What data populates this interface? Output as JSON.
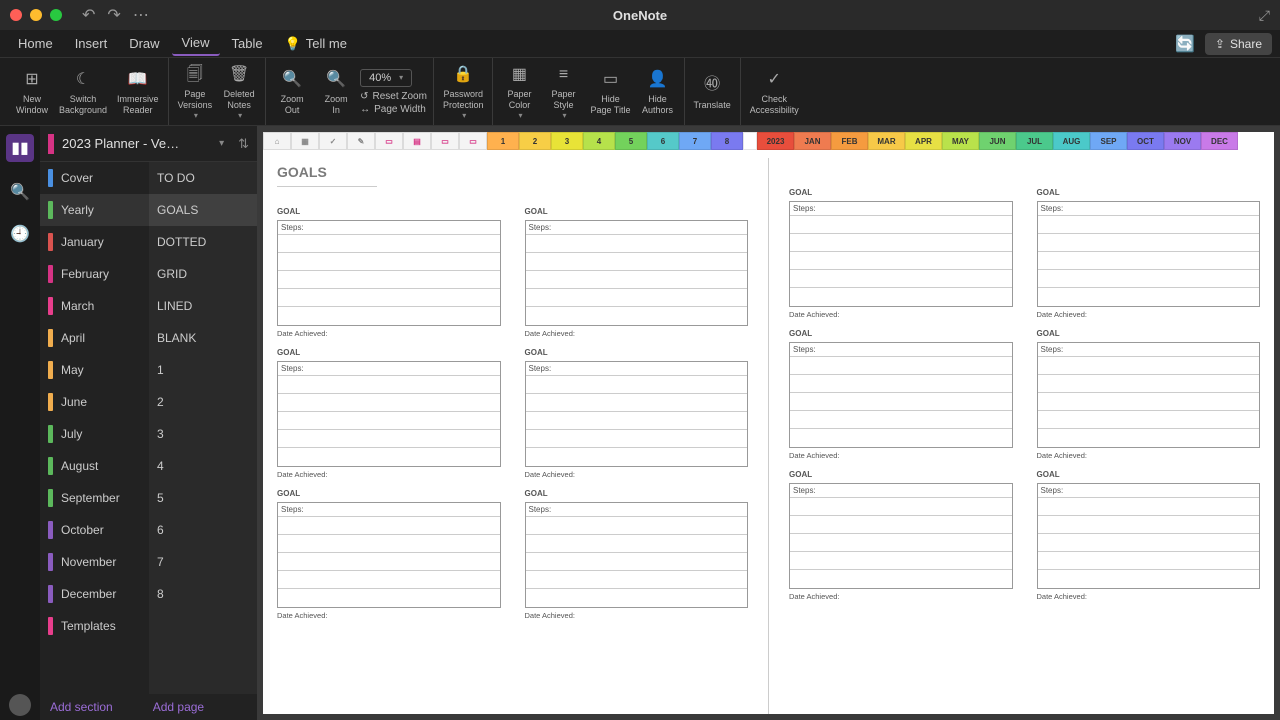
{
  "app": {
    "title": "OneNote"
  },
  "menu": {
    "items": [
      "Home",
      "Insert",
      "Draw",
      "View",
      "Table"
    ],
    "tellme": "Tell me",
    "share": "Share"
  },
  "ribbon": {
    "new_window": "New\nWindow",
    "switch_bg": "Switch\nBackground",
    "immersive": "Immersive\nReader",
    "page_versions": "Page\nVersions",
    "deleted_notes": "Deleted\nNotes",
    "zoom_out": "Zoom\nOut",
    "zoom_in": "Zoom\nIn",
    "zoom_level": "40%",
    "reset_zoom": "Reset Zoom",
    "page_width": "Page Width",
    "password": "Password\nProtection",
    "paper_color": "Paper\nColor",
    "paper_style": "Paper\nStyle",
    "hide_title": "Hide\nPage Title",
    "hide_authors": "Hide\nAuthors",
    "translate": "Translate",
    "accessibility": "Check\nAccessibility"
  },
  "notebook": {
    "name": "2023 Planner - Ve…"
  },
  "sections": [
    {
      "label": "Cover",
      "color": "#4a90e2"
    },
    {
      "label": "Yearly",
      "color": "#5cb85c"
    },
    {
      "label": "January",
      "color": "#d9534f"
    },
    {
      "label": "February",
      "color": "#d63384"
    },
    {
      "label": "March",
      "color": "#e83e8c"
    },
    {
      "label": "April",
      "color": "#f0ad4e"
    },
    {
      "label": "May",
      "color": "#f0ad4e"
    },
    {
      "label": "June",
      "color": "#f0ad4e"
    },
    {
      "label": "July",
      "color": "#5cb85c"
    },
    {
      "label": "August",
      "color": "#5cb85c"
    },
    {
      "label": "September",
      "color": "#5cb85c"
    },
    {
      "label": "October",
      "color": "#8a5cbf"
    },
    {
      "label": "November",
      "color": "#8a5cbf"
    },
    {
      "label": "December",
      "color": "#8a5cbf"
    },
    {
      "label": "Templates",
      "color": "#e83e8c"
    }
  ],
  "pages": [
    "TO DO",
    "GOALS",
    "DOTTED",
    "GRID",
    "LINED",
    "BLANK",
    "1",
    "2",
    "3",
    "4",
    "5",
    "6",
    "7",
    "8"
  ],
  "footer": {
    "add_section": "Add section",
    "add_page": "Add page"
  },
  "canvas": {
    "title": "GOALS",
    "goal_label": "GOAL",
    "steps_label": "Steps:",
    "date_label": "Date Achieved:",
    "icon_tabs": [
      "⌂",
      "▦",
      "✓",
      "✎",
      "▭",
      "▤",
      "▭",
      "▭"
    ],
    "num_tabs": [
      {
        "label": "1",
        "color": "#ffb14e"
      },
      {
        "label": "2",
        "color": "#f7ce46"
      },
      {
        "label": "3",
        "color": "#e8e337"
      },
      {
        "label": "4",
        "color": "#b6e24b"
      },
      {
        "label": "5",
        "color": "#73d25c"
      },
      {
        "label": "6",
        "color": "#55c9c9"
      },
      {
        "label": "7",
        "color": "#6fa8f5"
      },
      {
        "label": "8",
        "color": "#7a7af0"
      }
    ],
    "month_tabs": [
      {
        "label": "2023",
        "color": "#e84e3c"
      },
      {
        "label": "JAN",
        "color": "#ef7b50"
      },
      {
        "label": "FEB",
        "color": "#f59b3f"
      },
      {
        "label": "MAR",
        "color": "#f7c948"
      },
      {
        "label": "APR",
        "color": "#e7e044"
      },
      {
        "label": "MAY",
        "color": "#b9e24b"
      },
      {
        "label": "JUN",
        "color": "#6fd26f"
      },
      {
        "label": "JUL",
        "color": "#4bc98c"
      },
      {
        "label": "AUG",
        "color": "#4bc9c9"
      },
      {
        "label": "SEP",
        "color": "#6fa8f5"
      },
      {
        "label": "OCT",
        "color": "#7a7af0"
      },
      {
        "label": "NOV",
        "color": "#9b7af0"
      },
      {
        "label": "DEC",
        "color": "#c97ae8"
      }
    ]
  }
}
